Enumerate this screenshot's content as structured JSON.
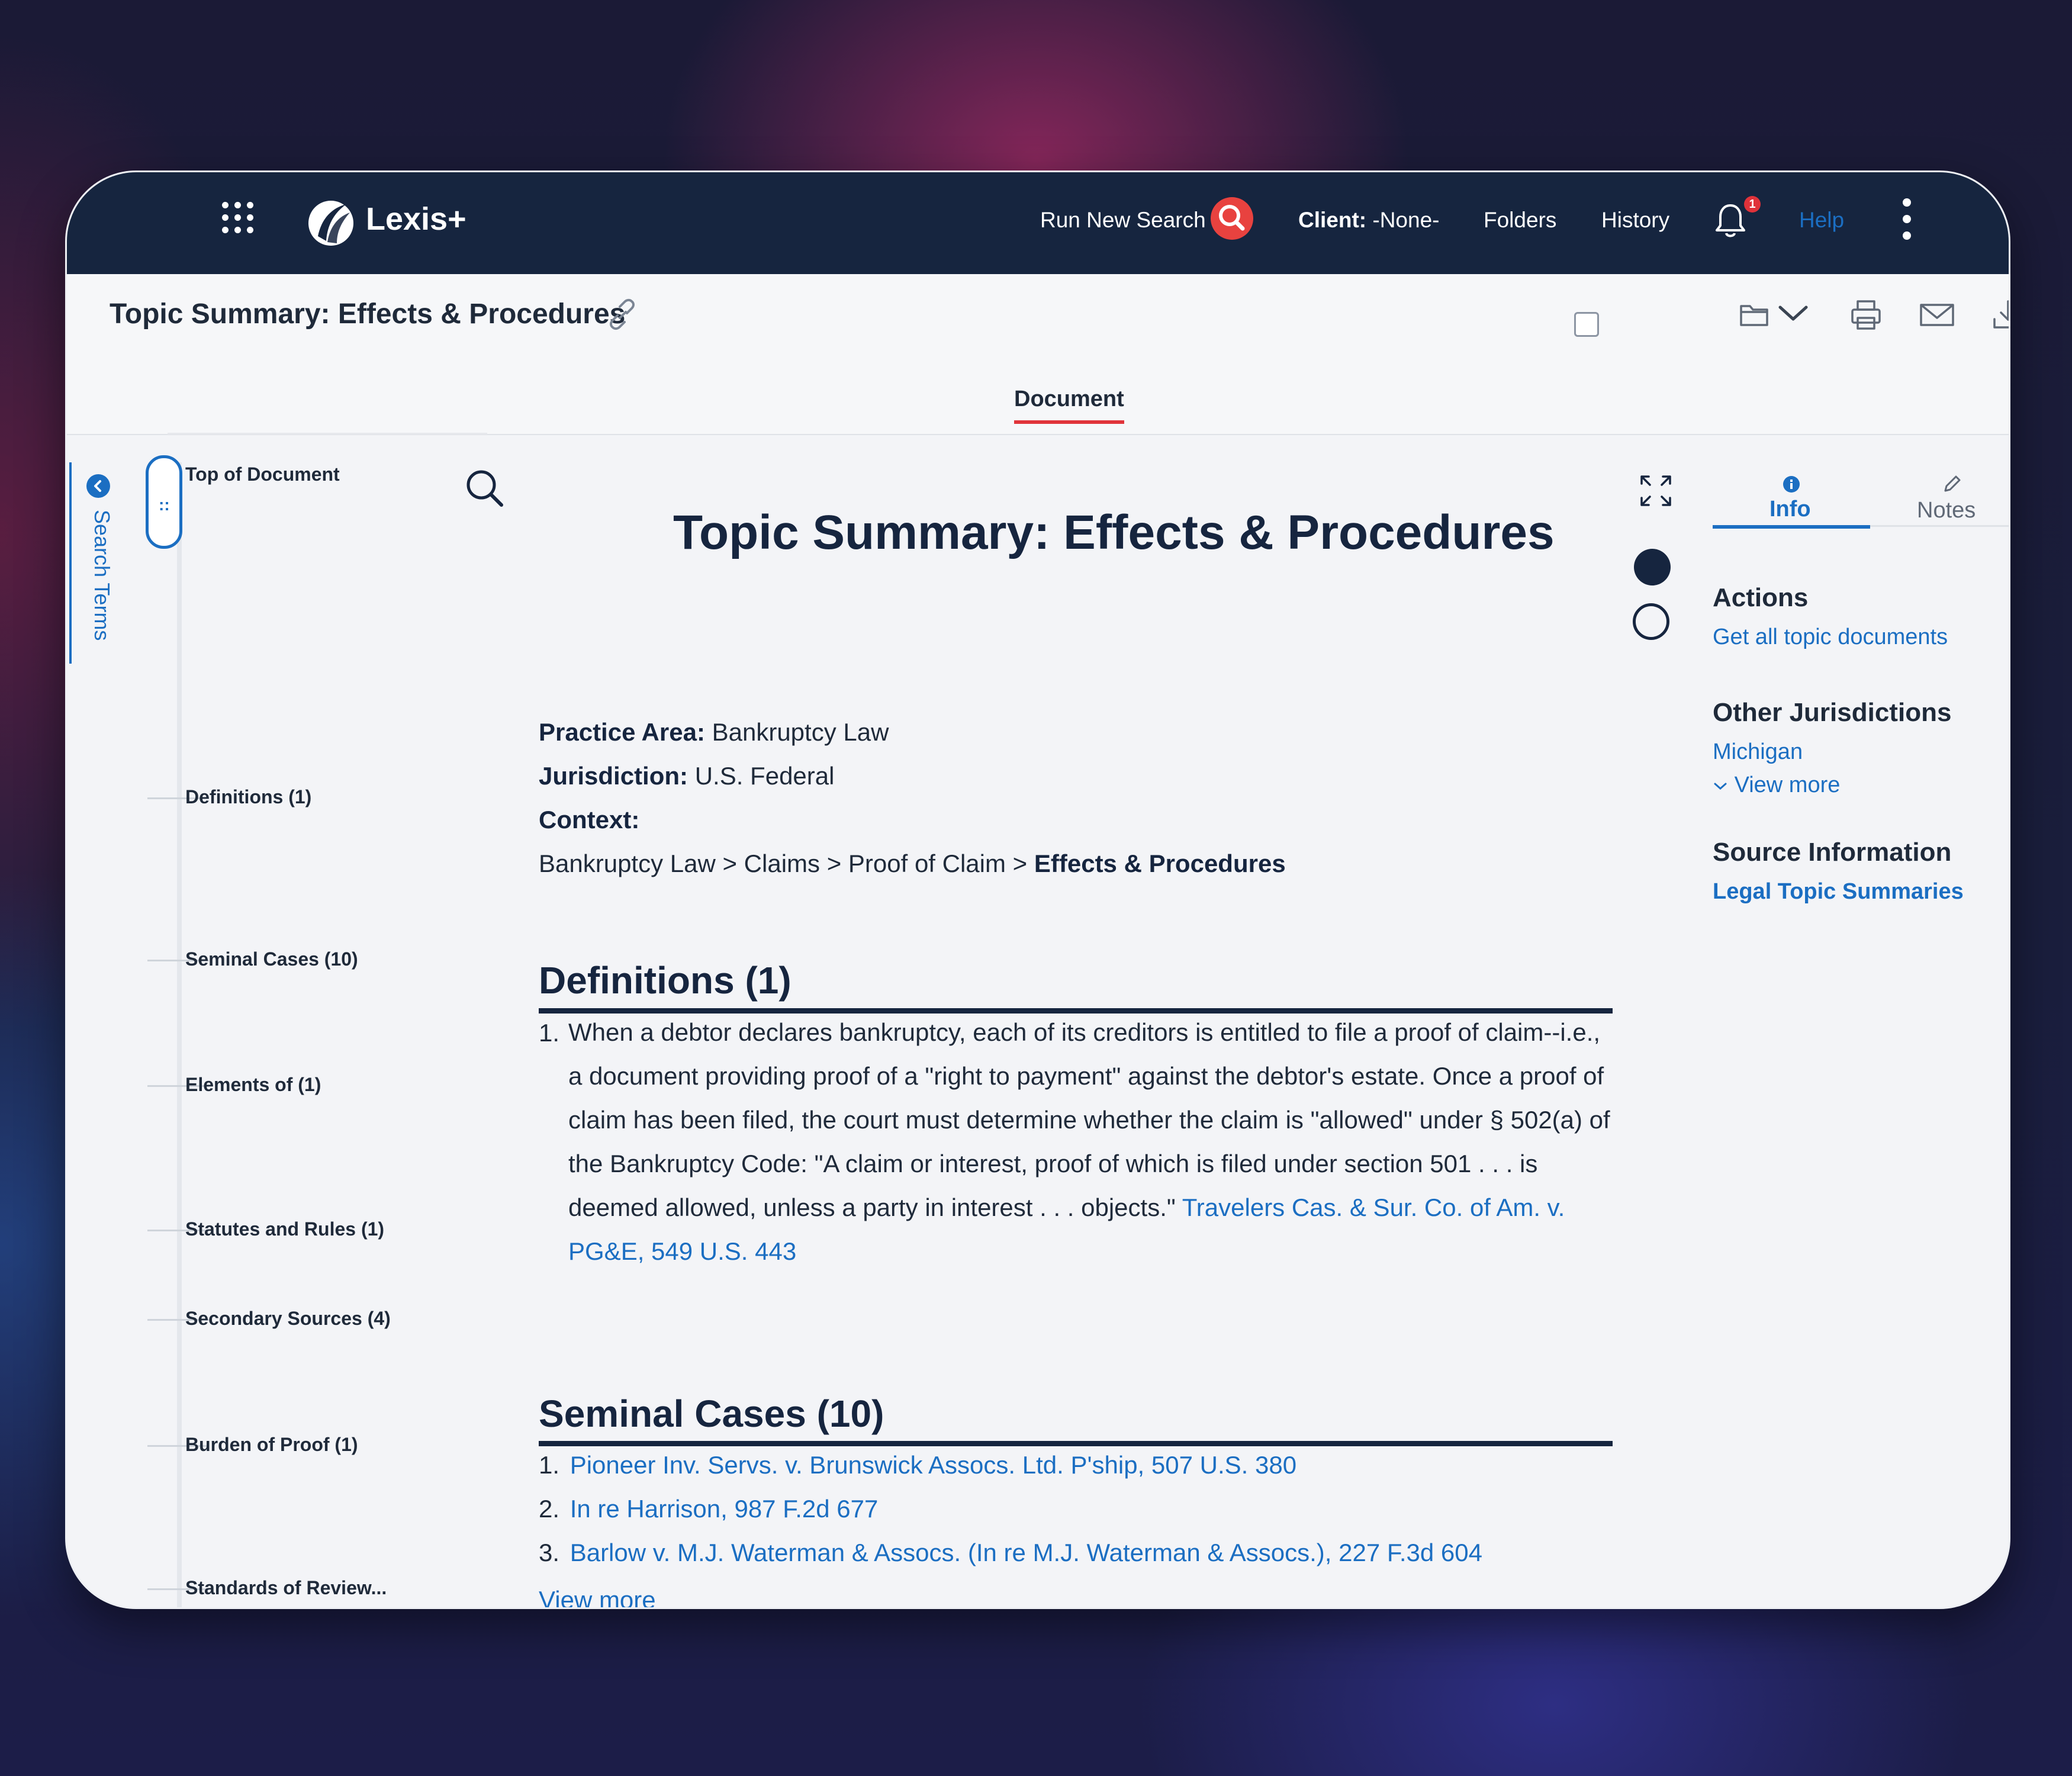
{
  "topbar": {
    "logo": "Lexis+",
    "run_new_search": "Run New Search",
    "client_label": "Client:",
    "client_value": "-None-",
    "folders": "Folders",
    "history": "History",
    "notification_count": "1",
    "help": "Help"
  },
  "doc_header": {
    "title": "Topic Summary: Effects & Procedures",
    "tab": "Document"
  },
  "sidebar": {
    "search_terms": "Search Terms",
    "toc": [
      "Top of Document",
      "Definitions (1)",
      "Seminal Cases (10)",
      "Elements of (1)",
      "Statutes and Rules (1)",
      "Secondary Sources (4)",
      "Burden of Proof (1)",
      "Standards of Review..."
    ]
  },
  "document": {
    "title": "Topic Summary: Effects & Procedures",
    "practice_area_label": "Practice Area:",
    "practice_area": "Bankruptcy Law",
    "jurisdiction_label": "Jurisdiction:",
    "jurisdiction": "U.S. Federal",
    "context_label": "Context:",
    "context_path": "Bankruptcy Law > Claims > Proof of Claim >",
    "context_current": "Effects & Procedures",
    "definitions": {
      "heading": "Definitions (1)",
      "number": "1.",
      "text": "When a debtor declares bankruptcy, each of its creditors is entitled to file a proof of claim--i.e., a document providing proof of a \"right to payment\" against the debtor's estate. Once a proof of claim has been filed, the court must determine whether the claim is \"allowed\" under § 502(a) of the Bankruptcy Code: \"A claim or interest, proof of which is filed under section 501 . . . is deemed allowed, unless a party in interest . . . objects.\"",
      "citation": "Travelers Cas. & Sur. Co. of Am. v. PG&E, 549 U.S. 443"
    },
    "seminal_cases": {
      "heading": "Seminal Cases (10)",
      "items": [
        {
          "num": "1.",
          "title": "Pioneer Inv. Servs. v. Brunswick Assocs. Ltd. P'ship, 507 U.S. 380"
        },
        {
          "num": "2.",
          "title": "In re Harrison, 987 F.2d 677"
        },
        {
          "num": "3.",
          "title": "Barlow v. M.J. Waterman & Assocs. (In re M.J. Waterman & Assocs.), 227 F.3d 604"
        }
      ],
      "view_more": "View more"
    }
  },
  "right_panel": {
    "tab_info": "Info",
    "tab_notes": "Notes",
    "actions_heading": "Actions",
    "get_all_topic_documents": "Get all topic documents",
    "other_jurisdictions_heading": "Other Jurisdictions",
    "michigan": "Michigan",
    "view_more": "View more",
    "source_information_heading": "Source Information",
    "legal_topic_summaries": "Legal Topic Summaries"
  },
  "colors": {
    "navy": "#16253f",
    "link_blue": "#1b6ec2",
    "accent_red": "#e0343a"
  },
  "icons": [
    "apps-grid-icon",
    "lexis-logo-icon",
    "search-icon",
    "bell-icon",
    "more-vertical-icon",
    "link-icon",
    "folder-icon",
    "chevron-down-icon",
    "print-icon",
    "email-icon",
    "download-icon",
    "find-in-document-icon",
    "expand-icon",
    "info-icon",
    "pencil-icon"
  ]
}
